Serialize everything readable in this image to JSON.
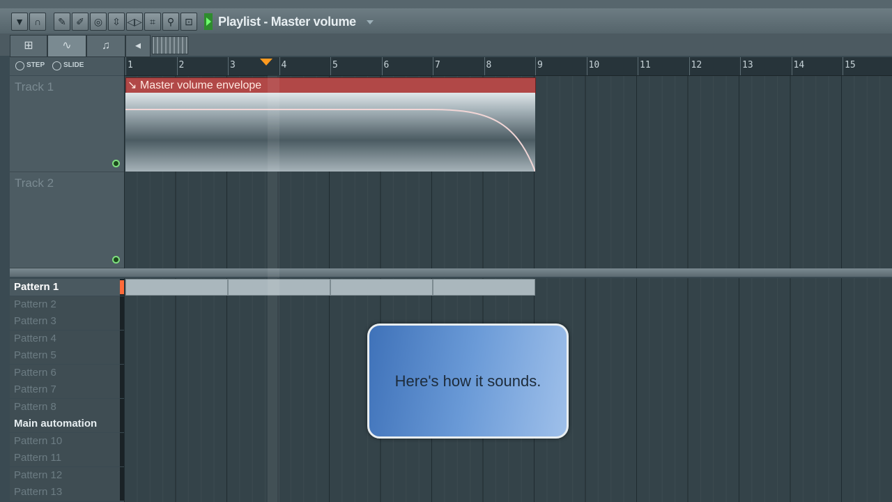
{
  "window": {
    "title": "Playlist - Master volume"
  },
  "toolbar": {
    "tools": [
      {
        "name": "menu-arrow-icon",
        "glyph": "▼"
      },
      {
        "name": "magnet-icon",
        "glyph": "∩"
      },
      {
        "name": "pencil-icon",
        "glyph": "✎"
      },
      {
        "name": "brush-icon",
        "glyph": "✐"
      },
      {
        "name": "mute-icon",
        "glyph": "◎"
      },
      {
        "name": "slip-icon",
        "glyph": "⇳"
      },
      {
        "name": "slice-icon",
        "glyph": "◁▷"
      },
      {
        "name": "select-icon",
        "glyph": "⌗"
      },
      {
        "name": "zoom-icon",
        "glyph": "⚲"
      },
      {
        "name": "playback-icon",
        "glyph": "⊡"
      }
    ]
  },
  "tabs": [
    {
      "name": "tab-patterns",
      "glyph": "⊞"
    },
    {
      "name": "tab-automation",
      "glyph": "∿"
    },
    {
      "name": "tab-audio",
      "glyph": "♫"
    },
    {
      "name": "tab-back",
      "glyph": "◂"
    }
  ],
  "options": {
    "step": "STEP",
    "slide": "SLIDE"
  },
  "ruler": {
    "ticks": [
      "1",
      "2",
      "3",
      "4",
      "5",
      "6",
      "7",
      "8",
      "9",
      "10",
      "11",
      "12",
      "13",
      "14",
      "15"
    ]
  },
  "tracks": [
    {
      "name": "Track 1"
    },
    {
      "name": "Track 2"
    }
  ],
  "clip": {
    "label": "Master volume envelope"
  },
  "patterns": [
    {
      "name": "Pattern 1",
      "state": "selected"
    },
    {
      "name": "Pattern 2",
      "state": "normal"
    },
    {
      "name": "Pattern 3",
      "state": "normal"
    },
    {
      "name": "Pattern 4",
      "state": "normal"
    },
    {
      "name": "Pattern 5",
      "state": "normal"
    },
    {
      "name": "Pattern 6",
      "state": "normal"
    },
    {
      "name": "Pattern 7",
      "state": "normal"
    },
    {
      "name": "Pattern 8",
      "state": "normal"
    },
    {
      "name": "Main automation",
      "state": "main"
    },
    {
      "name": "Pattern 10",
      "state": "normal"
    },
    {
      "name": "Pattern 11",
      "state": "normal"
    },
    {
      "name": "Pattern 12",
      "state": "normal"
    },
    {
      "name": "Pattern 13",
      "state": "normal"
    }
  ],
  "balloon": {
    "text": "Here's how it sounds."
  },
  "colors": {
    "clip_header": "#b14847",
    "marker": "#ff9a1f",
    "balloon": "#6a9ad7",
    "track_bg": "#344349"
  }
}
